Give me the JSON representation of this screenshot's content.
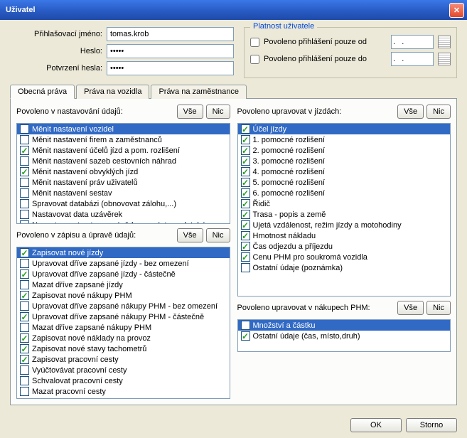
{
  "window": {
    "title": "Uživatel"
  },
  "login": {
    "username_label": "Přihlašovací jméno:",
    "username_value": "tomas.krob",
    "password_label": "Heslo:",
    "password_value": "•••••",
    "confirm_label": "Potvrzení hesla:",
    "confirm_value": "•••••"
  },
  "validity": {
    "legend": "Platnost uživatele",
    "from_label": "Povoleno přihlášení pouze od",
    "to_label": "Povoleno přihlášení pouze do",
    "from_value": ".   .",
    "to_value": ".   ."
  },
  "tabs": {
    "tab1": "Obecná práva",
    "tab2": "Práva na vozidla",
    "tab3": "Práva na zaměstnance"
  },
  "buttons": {
    "all": "Vše",
    "none": "Nic",
    "ok": "OK",
    "cancel": "Storno"
  },
  "section1": {
    "title": "Povoleno v nastavování údajů:",
    "items": [
      {
        "label": "Měnit nastavení vozidel",
        "checked": false,
        "selected": true
      },
      {
        "label": "Měnit nastavení firem a zaměstnanců",
        "checked": false,
        "selected": false
      },
      {
        "label": "Měnit nastavení účelů jízd a pom. rozlišení",
        "checked": true,
        "selected": false
      },
      {
        "label": "Měnit nastavení sazeb cestovních náhrad",
        "checked": false,
        "selected": false
      },
      {
        "label": "Měnit nastavení obvyklých jízd",
        "checked": true,
        "selected": false
      },
      {
        "label": "Měnit nastavení práv uživatelů",
        "checked": false,
        "selected": false
      },
      {
        "label": "Měnit nastavení sestav",
        "checked": false,
        "selected": false
      },
      {
        "label": "Spravovat databázi (obnovovat zálohu,...)",
        "checked": false,
        "selected": false
      },
      {
        "label": "Nastavovat data uzávěrek",
        "checked": false,
        "selected": false
      },
      {
        "label": "Nenastavovat autom. uzávěrku po výstupu databáze",
        "checked": false,
        "selected": false
      }
    ]
  },
  "section2": {
    "title": "Povoleno v zápisu a úpravě údajů:",
    "items": [
      {
        "label": "Zapisovat nové jízdy",
        "checked": true,
        "selected": true
      },
      {
        "label": "Upravovat dříve zapsané jízdy - bez omezení",
        "checked": false,
        "selected": false
      },
      {
        "label": "Upravovat dříve zapsané jízdy - částečně",
        "checked": true,
        "selected": false
      },
      {
        "label": "Mazat dříve zapsané jízdy",
        "checked": false,
        "selected": false
      },
      {
        "label": "Zapisovat nové nákupy PHM",
        "checked": true,
        "selected": false
      },
      {
        "label": "Upravovat dříve zapsané nákupy PHM - bez omezení",
        "checked": false,
        "selected": false
      },
      {
        "label": "Upravovat dříve zapsané nákupy PHM - částečně",
        "checked": true,
        "selected": false
      },
      {
        "label": "Mazat dříve zapsané nákupy PHM",
        "checked": false,
        "selected": false
      },
      {
        "label": "Zapisovat nové náklady na provoz",
        "checked": true,
        "selected": false
      },
      {
        "label": "Zapisovat nové stavy tachometrů",
        "checked": true,
        "selected": false
      },
      {
        "label": "Zapisovat pracovní cesty",
        "checked": true,
        "selected": false
      },
      {
        "label": "Vyúčtovávat pracovní cesty",
        "checked": false,
        "selected": false
      },
      {
        "label": "Schvalovat pracovní cesty",
        "checked": false,
        "selected": false
      },
      {
        "label": "Mazat pracovní cesty",
        "checked": false,
        "selected": false
      }
    ]
  },
  "section3": {
    "title": "Povoleno upravovat v jízdách:",
    "items": [
      {
        "label": "Účel jízdy",
        "checked": true,
        "selected": true
      },
      {
        "label": "1. pomocné rozlišení",
        "checked": true,
        "selected": false
      },
      {
        "label": "2. pomocné rozlišení",
        "checked": true,
        "selected": false
      },
      {
        "label": "3. pomocné rozlišení",
        "checked": true,
        "selected": false
      },
      {
        "label": "4. pomocné rozlišení",
        "checked": true,
        "selected": false
      },
      {
        "label": "5. pomocné rozlišení",
        "checked": true,
        "selected": false
      },
      {
        "label": "6. pomocné rozlišení",
        "checked": true,
        "selected": false
      },
      {
        "label": "Řidič",
        "checked": true,
        "selected": false
      },
      {
        "label": "Trasa - popis a země",
        "checked": true,
        "selected": false
      },
      {
        "label": "Ujetá vzdálenost, režim jízdy a motohodiny",
        "checked": true,
        "selected": false
      },
      {
        "label": "Hmotnost nákladu",
        "checked": true,
        "selected": false
      },
      {
        "label": "Čas odjezdu a příjezdu",
        "checked": true,
        "selected": false
      },
      {
        "label": "Cenu PHM pro soukromá vozidla",
        "checked": true,
        "selected": false
      },
      {
        "label": "Ostatní údaje (poznámka)",
        "checked": false,
        "selected": false
      }
    ]
  },
  "section4": {
    "title": "Povoleno upravovat v nákupech PHM:",
    "items": [
      {
        "label": "Množství a částku",
        "checked": false,
        "selected": true
      },
      {
        "label": "Ostatní údaje (čas, místo,druh)",
        "checked": true,
        "selected": false
      }
    ]
  }
}
